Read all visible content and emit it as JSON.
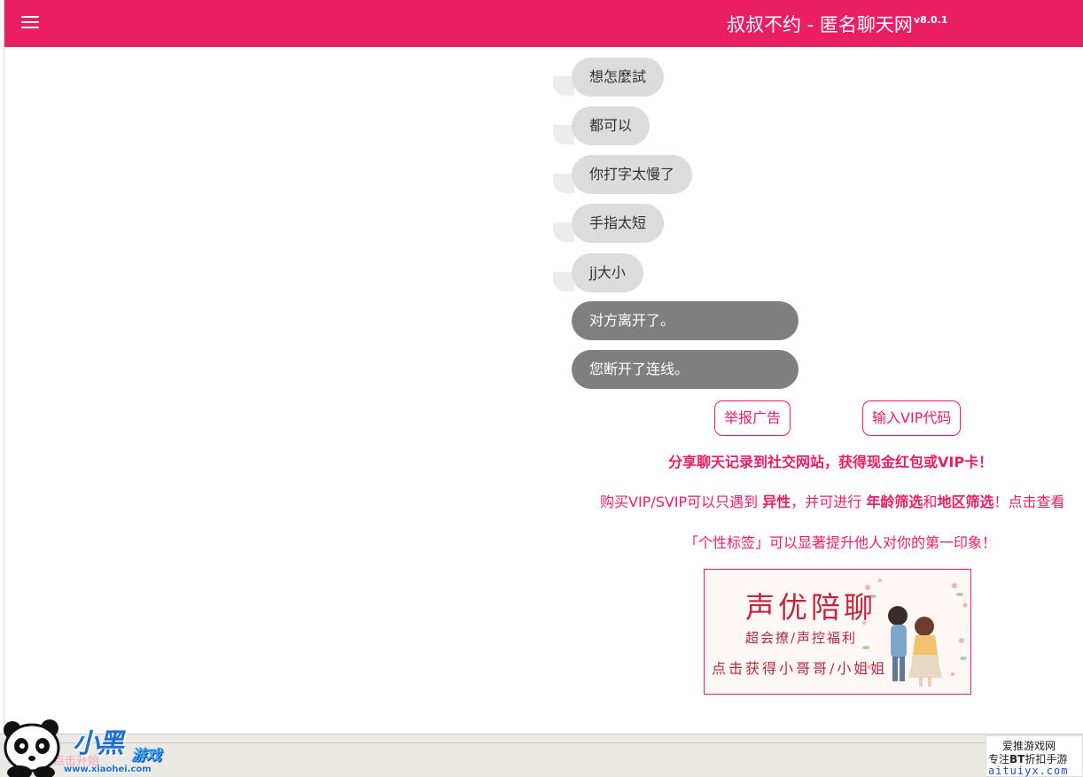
{
  "header": {
    "title": "叔叔不约 - 匿名聊天网",
    "version": "v8.0.1",
    "menu_icon": "hamburger-menu-icon",
    "color": "#e91e63"
  },
  "chat": {
    "messages": [
      {
        "text": "想怎麼試"
      },
      {
        "text": "都可以"
      },
      {
        "text": "你打字太慢了"
      },
      {
        "text": "手指太短"
      },
      {
        "text": "jj大小"
      }
    ],
    "system_messages": [
      {
        "text": "对方离开了。"
      },
      {
        "text": "您断开了连线。"
      }
    ],
    "bubble_color": "#dcdcdc",
    "system_color": "#7f7f7f"
  },
  "actions": {
    "report_label": "举报广告",
    "vip_code_label": "输入VIP代码"
  },
  "promo": {
    "share_line": "分享聊天记录到社交网站，获得现金红包或VIP卡！",
    "vip_line_a": "购买VIP/SVIP可以只遇到",
    "vip_line_b": "异性",
    "vip_line_c": "，并可进行",
    "vip_line_d": "年龄筛选",
    "vip_line_e": "和",
    "vip_line_f": "地区筛选",
    "vip_line_g": "！点击查看",
    "tag_line": "「个性标签」可以显著提升他人对你的第一印象！"
  },
  "banner": {
    "title": "声优陪聊",
    "subtitle": "超会撩/声控福利",
    "cta": "点击获得小哥哥/小姐姐"
  },
  "bottom": {
    "hint": "点击开始"
  },
  "watermarks": {
    "left_brand": "小黑",
    "left_game": "游戏",
    "left_url": "www.xiaohei.com",
    "right_name": "爱推游戏网",
    "right_tagline_a": "专注",
    "right_tagline_b": "BT",
    "right_tagline_c": "折扣手游",
    "right_url": "aituiyx.com"
  }
}
